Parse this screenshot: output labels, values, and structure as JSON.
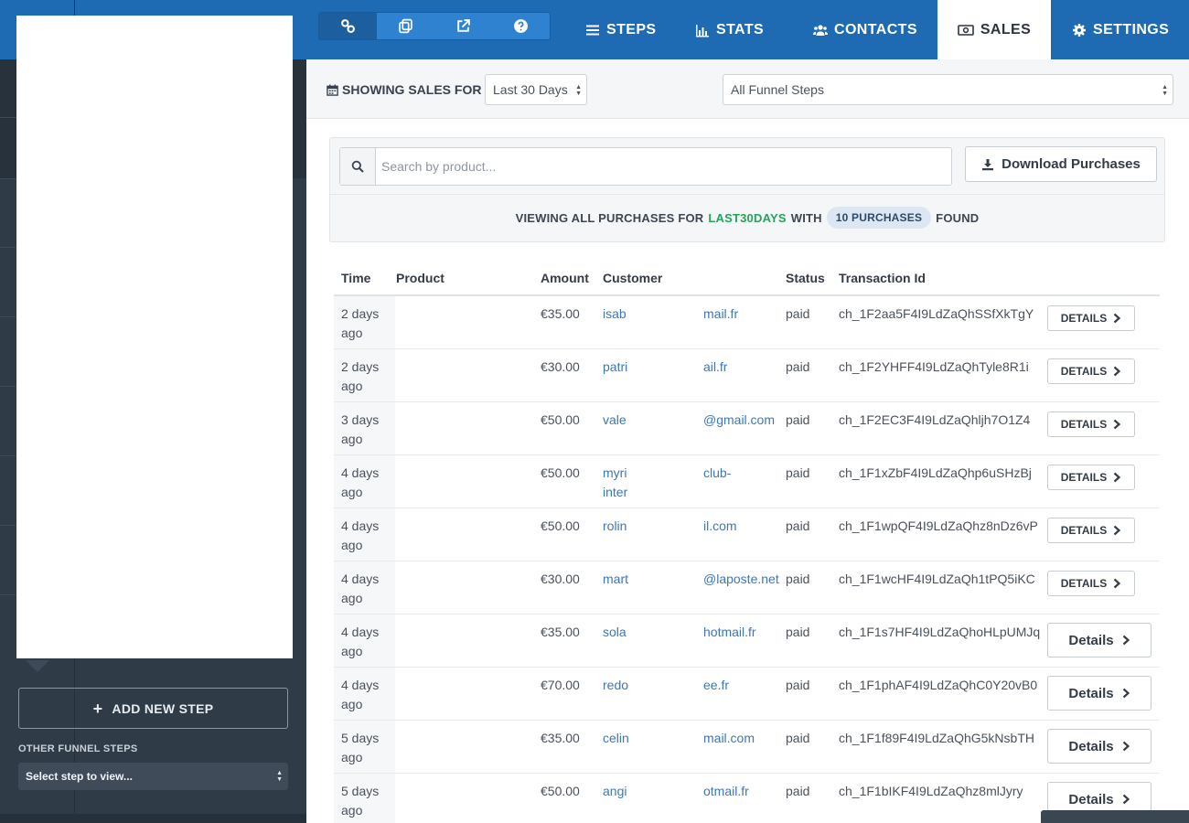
{
  "sidebar": {
    "add_step_label": "ADD NEW STEP",
    "other_steps_label": "OTHER FUNNEL STEPS",
    "step_select_value": "Select step to view..."
  },
  "topnav": {
    "tabs": [
      {
        "label": "STEPS",
        "icon": "list-icon"
      },
      {
        "label": "STATS",
        "icon": "bar-chart-icon"
      },
      {
        "label": "CONTACTS",
        "icon": "users-icon"
      },
      {
        "label": "SALES",
        "icon": "money-icon",
        "active": true
      },
      {
        "label": "SETTINGS",
        "icon": "gear-icon"
      }
    ],
    "toolbar_icons": [
      "link-icon",
      "copy-icon",
      "external-link-icon",
      "help-icon"
    ]
  },
  "filters": {
    "showing_label": "SHOWING SALES FOR",
    "range_value": "Last 30 Days",
    "steps_value": "All Funnel Steps"
  },
  "search": {
    "placeholder": "Search by product..."
  },
  "download_label": "Download Purchases",
  "summary": {
    "prefix": "VIEWING ALL PURCHASES FOR",
    "range": "LAST30DAYS",
    "with": "WITH",
    "count": "10 PURCHASES",
    "suffix": "FOUND"
  },
  "table": {
    "headers": {
      "time": "Time",
      "product": "Product",
      "amount": "Amount",
      "customer": "Customer",
      "status": "Status",
      "transaction": "Transaction Id"
    },
    "rows": [
      {
        "time": "2 days ago",
        "amount": "€35.00",
        "cust_a": "isab",
        "cust_b": "mail.fr",
        "status": "paid",
        "txn": "ch_1F2aa5F4I9LdZaQhSSfXkTgY",
        "details": "DETAILS",
        "style": "sm"
      },
      {
        "time": "2 days ago",
        "amount": "€30.00",
        "cust_a": "patri",
        "cust_b": "ail.fr",
        "status": "paid",
        "txn": "ch_1F2YHFF4I9LdZaQhTyle8R1i",
        "details": "DETAILS",
        "style": "sm"
      },
      {
        "time": "3 days ago",
        "amount": "€50.00",
        "cust_a": "vale",
        "cust_b": "@gmail.com",
        "status": "paid",
        "txn": "ch_1F2EC3F4I9LdZaQhljh7O1Z4",
        "details": "DETAILS",
        "style": "sm"
      },
      {
        "time": "4 days ago",
        "amount": "€50.00",
        "cust_a": "myri\ninter",
        "cust_b": "club-",
        "status": "paid",
        "txn": "ch_1F1xZbF4I9LdZaQhp6uSHzBj",
        "details": "DETAILS",
        "style": "sm"
      },
      {
        "time": "4 days ago",
        "amount": "€50.00",
        "cust_a": "rolin",
        "cust_b": "il.com",
        "status": "paid",
        "txn": "ch_1F1wpQF4I9LdZaQhz8nDz6vP",
        "details": "DETAILS",
        "style": "sm"
      },
      {
        "time": "4 days ago",
        "amount": "€30.00",
        "cust_a": "mart",
        "cust_b": "@laposte.net",
        "status": "paid",
        "txn": "ch_1F1wcHF4I9LdZaQh1tPQ5iKC",
        "details": "DETAILS",
        "style": "sm"
      },
      {
        "time": "4 days ago",
        "amount": "€35.00",
        "cust_a": "sola",
        "cust_b": "hotmail.fr",
        "status": "paid",
        "txn": "ch_1F1s7HF4I9LdZaQhoHLpUMJq",
        "details": "Details",
        "style": "lg"
      },
      {
        "time": "4 days ago",
        "amount": "€70.00",
        "cust_a": "redo",
        "cust_b": "ee.fr",
        "status": "paid",
        "txn": "ch_1F1phAF4I9LdZaQhC0Y20vB0",
        "details": "Details",
        "style": "lg"
      },
      {
        "time": "5 days ago",
        "amount": "€35.00",
        "cust_a": "celin",
        "cust_b": "mail.com",
        "status": "paid",
        "txn": "ch_1F1f89F4I9LdZaQhG5kNsbTH",
        "details": "Details",
        "style": "lg"
      },
      {
        "time": "5 days ago",
        "amount": "€50.00",
        "cust_a": "angi",
        "cust_b": "otmail.fr",
        "status": "paid",
        "txn": "ch_1F1bIKF4I9LdZaQhz8mlJyry",
        "details": "Details",
        "style": "lg"
      }
    ]
  },
  "colors": {
    "brand_blue": "#1e6bb3",
    "sidebar_dark": "#2f3b47",
    "link_blue": "#3a78b8",
    "accent_green": "#27a35a"
  }
}
